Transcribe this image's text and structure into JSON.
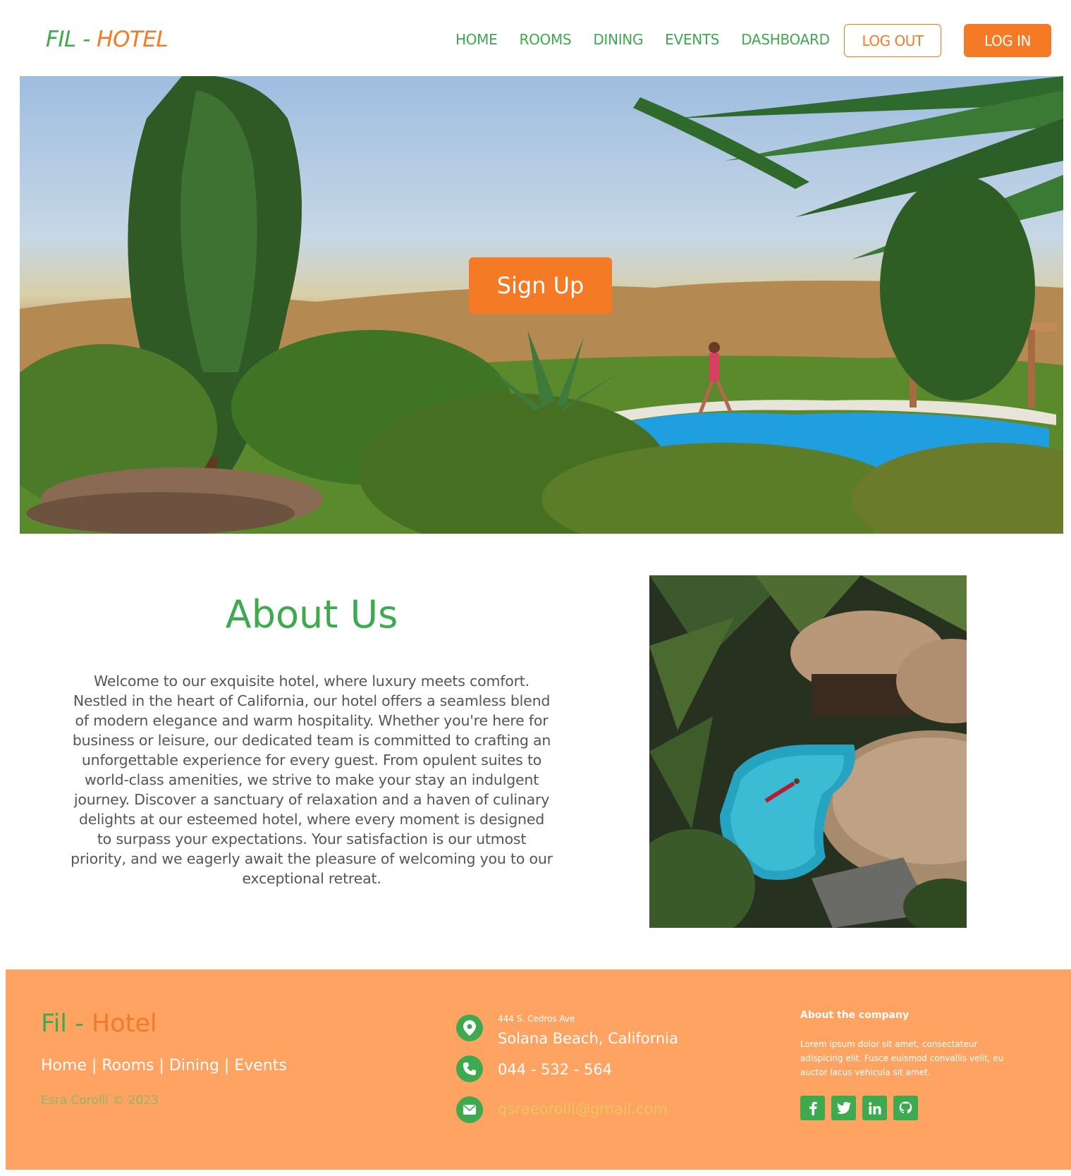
{
  "navbar": {
    "brand_part1": "FIL - ",
    "brand_part2": "HOTEL",
    "links": [
      "HOME",
      "ROOMS",
      "DINING",
      "EVENTS",
      "DASHBOARD"
    ],
    "logout_label": "LOG OUT",
    "login_label": "LOG IN"
  },
  "hero": {
    "signup_label": "Sign Up"
  },
  "about": {
    "title": "About Us",
    "text": "Welcome to our exquisite hotel, where luxury meets comfort. Nestled in the heart of California, our hotel offers a seamless blend of modern elegance and warm hospitality. Whether you're here for business or leisure, our dedicated team is committed to crafting an unforgettable experience for every guest. From opulent suites to world-class amenities, we strive to make your stay an indulgent journey. Discover a sanctuary of relaxation and a haven of culinary delights at our esteemed hotel, where every moment is designed to surpass your expectations. Your satisfaction is our utmost priority, and we eagerly await the pleasure of welcoming you to our exceptional retreat."
  },
  "footer": {
    "brand_part1": "Fil - ",
    "brand_part2": "Hotel",
    "links": [
      "Home",
      "Rooms",
      "Dining",
      "Events"
    ],
    "copyright": "Esra Corolli © 2023",
    "address_line1": "444 S. Cedros Ave",
    "address_line2": "Solana Beach, California",
    "phone": "044 - 532 - 564",
    "email": "qsraeorolli@gmail.com",
    "about_title": "About the company",
    "about_text": "Lorem ipsum dolor sit amet, consectateur adispicing elit. Fusce euismod convallis velit, eu auctor lacus vehicula sit amet.",
    "socials": [
      {
        "icon": "facebook-icon",
        "glyph": "f"
      },
      {
        "icon": "twitter-icon",
        "glyph": "t"
      },
      {
        "icon": "linkedin-icon",
        "glyph": "in"
      },
      {
        "icon": "github-icon",
        "glyph": "gh"
      }
    ]
  },
  "colors": {
    "brand_green": "#3daa4f",
    "brand_orange": "#f47a25",
    "footer_bg": "#fea362"
  }
}
